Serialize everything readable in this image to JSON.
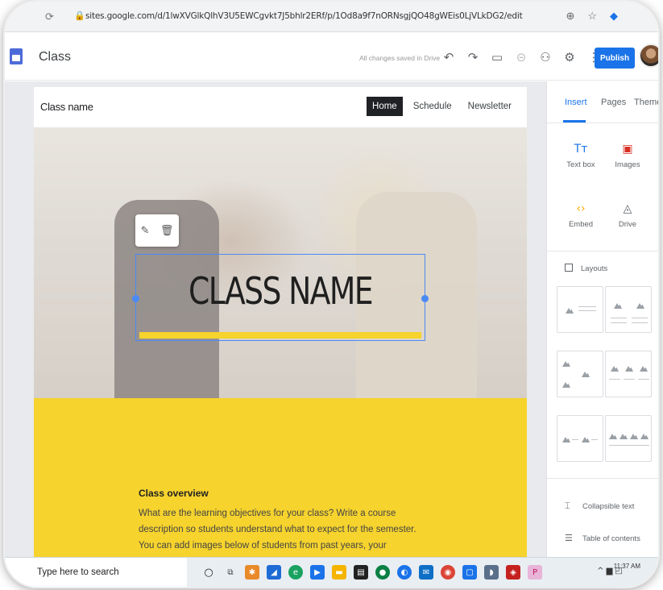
{
  "browser": {
    "url": "sites.google.com/d/1lwXVGlkQlhV3U5EWCgvkt7J5bhlr2ERf/p/1Od8a9f7nORNsgjQO48gWEis0LjVLkDG2/edit"
  },
  "app": {
    "title": "Class",
    "save_status": "All changes saved in Drive",
    "publish_label": "Publish"
  },
  "site": {
    "name": "Class name",
    "nav": [
      "Home",
      "Schedule",
      "Newsletter"
    ],
    "hero_title": "CLASS NAME",
    "overview_title": "Class overview",
    "overview_body": "What are the learning objectives for your class? Write a course description so students understand what to expect for the semester. You can add images below of students from past years, your classroom, or class projects."
  },
  "panel": {
    "tabs": [
      "Insert",
      "Pages",
      "Themes"
    ],
    "items": [
      {
        "label": "Text box",
        "icon": "text-box-icon",
        "glyph": "Tт",
        "color": "#1a73e8"
      },
      {
        "label": "Images",
        "icon": "image-icon",
        "glyph": "▣",
        "color": "#d93025"
      },
      {
        "label": "Embed",
        "icon": "embed-icon",
        "glyph": "‹›",
        "color": "#f9ab00"
      },
      {
        "label": "Drive",
        "icon": "drive-icon",
        "glyph": "◬",
        "color": "#5f6368"
      }
    ],
    "layouts_label": "Layouts",
    "collapsible_text_label": "Collapsible text",
    "toc_label": "Table of contents"
  },
  "taskbar": {
    "search_placeholder": "Type here to search",
    "clock": "11:37 AM"
  }
}
